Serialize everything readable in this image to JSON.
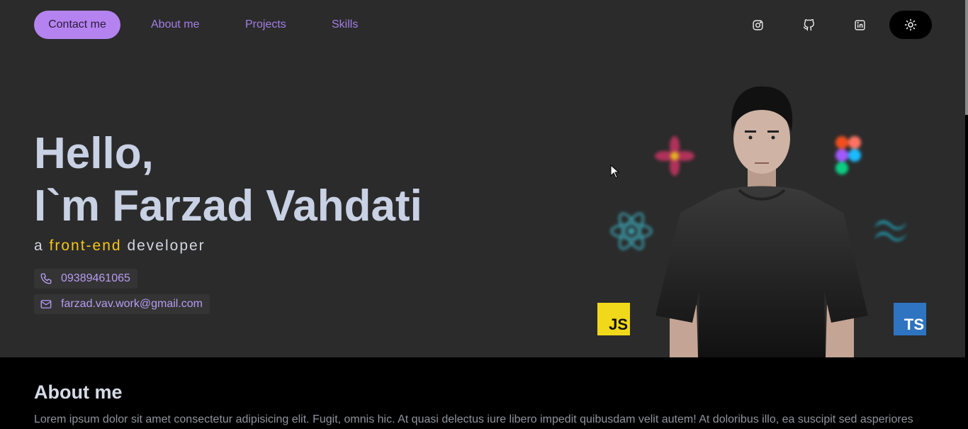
{
  "nav": {
    "contact_label": "Contact me",
    "about_label": "About me",
    "projects_label": "Projects",
    "skills_label": "Skills",
    "socials": [
      "instagram-icon",
      "github-icon",
      "linkedin-icon"
    ],
    "theme_icon": "sun-icon"
  },
  "hero": {
    "greeting": "Hello,",
    "name_line": "I`m Farzad Vahdati",
    "tagline_prefix": "a",
    "tagline_highlight": "front-end",
    "tagline_suffix": "developer",
    "phone": "09389461065",
    "email": "farzad.vav.work@gmail.com",
    "logos": {
      "js": "JS",
      "ts": "TS",
      "decor": [
        "react-icon",
        "figma-icon",
        "tailwind-icon",
        "atom-icon"
      ]
    }
  },
  "about": {
    "title": "About me",
    "text": "Lorem ipsum dolor sit amet consectetur adipisicing elit. Fugit, omnis hic. At quasi delectus iure libero impedit quibusdam velit autem! At doloribus illo, ea suscipit sed asperiores"
  },
  "colors": {
    "background": "#2b2b2b",
    "accent": "#b583f0",
    "highlight": "#f5c518",
    "heading": "#c9d1e4"
  }
}
